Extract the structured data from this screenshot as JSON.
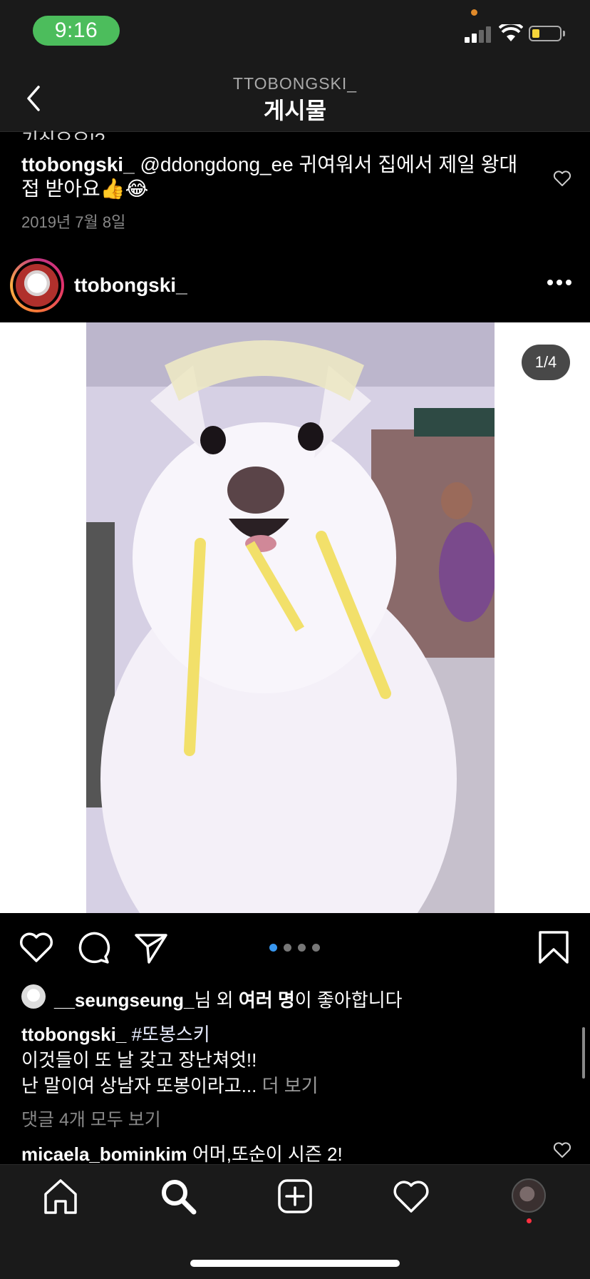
{
  "status_bar": {
    "time": "9:16"
  },
  "header": {
    "username": "TTOBONGSKI_",
    "title": "게시물"
  },
  "previous_comment": {
    "cut_text": "기쇠요요!?",
    "username": "ttobongski_",
    "mention": "@ddongdong_ee",
    "text": " 귀여워서 집에서 제일 왕대접 받아요👍😂",
    "date": "2019년 7월 8일"
  },
  "post": {
    "username": "ttobongski_",
    "image_counter": "1/4",
    "carousel": {
      "count": 4,
      "active": 1
    },
    "likes": {
      "user": "__seungseung_",
      "text1": "님 외 ",
      "bold": "여러 명",
      "text2": "이 좋아합니다"
    },
    "caption": {
      "username": "ttobongski_",
      "hashtag": " #또봉스키",
      "line2": "이것들이 또 날 갖고 장난쳐엇!!",
      "line3": "난 말이여 상남자 또봉이라고...",
      "more": " 더 보기"
    },
    "view_all_comments": "댓글 4개 모두 보기",
    "comment": {
      "username": "micaela_bominkim",
      "text": " 어머,또순이 시즌 2!"
    }
  },
  "colors": {
    "accent": "#3897f0",
    "status_green": "#4cbd5c",
    "notify": "#ff3040"
  },
  "icons": [
    "back-icon",
    "heart-icon",
    "comment-icon",
    "share-icon",
    "bookmark-icon",
    "home-icon",
    "search-icon",
    "add-icon",
    "activity-heart-icon",
    "more-icon"
  ]
}
